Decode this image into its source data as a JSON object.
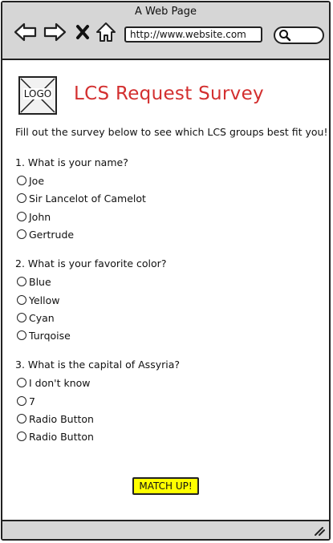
{
  "window": {
    "title": "A Web Page",
    "url": "http://www.website.com"
  },
  "icons": {
    "back": "arrow-left-icon",
    "forward": "arrow-right-icon",
    "close": "close-x-icon",
    "home": "home-icon",
    "search": "search-icon",
    "resize": "resize-grip-icon"
  },
  "header": {
    "logo_text": "LOGO",
    "title": "LCS Request Survey",
    "title_color": "#d32f2f"
  },
  "survey": {
    "intro": "Fill out the survey below to see which LCS groups best fit you!",
    "questions": [
      {
        "text": "1. What is your name?",
        "options": [
          "Joe",
          "Sir Lancelot of Camelot",
          "John",
          "Gertrude"
        ]
      },
      {
        "text": "2. What is your favorite color?",
        "options": [
          "Blue",
          "Yellow",
          "Cyan",
          "Turqoise"
        ]
      },
      {
        "text": "3. What is the capital of Assyria?",
        "options": [
          "I don't know",
          "7",
          "Radio Button",
          "Radio Button"
        ]
      }
    ]
  },
  "submit": {
    "label": "MATCH UP!",
    "color": "#ffff00"
  }
}
